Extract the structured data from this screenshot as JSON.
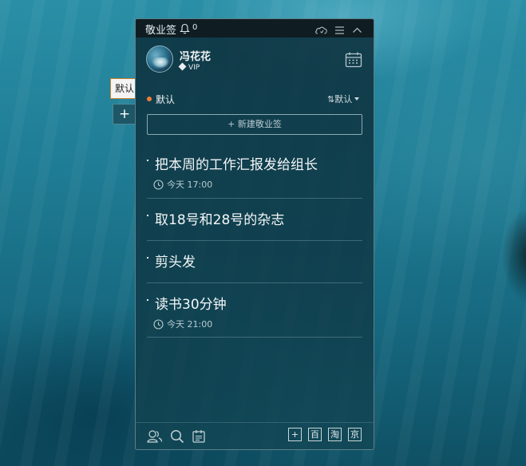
{
  "window": {
    "title": "敬业签",
    "notification_count": "0"
  },
  "side_tabs": {
    "category_label": "默认",
    "add_label": "+"
  },
  "profile": {
    "name": "冯花花",
    "badge": "VIP"
  },
  "category": {
    "name": "默认",
    "dot_color": "#ef7d35",
    "sort_label": "⇅默认"
  },
  "new_button": {
    "label": "+ 新建敬业签"
  },
  "tasks": [
    {
      "text": "把本周的工作汇报发给组长",
      "due": "今天 17:00"
    },
    {
      "text": "取18号和28号的杂志",
      "due": ""
    },
    {
      "text": "剪头发",
      "due": ""
    },
    {
      "text": "读书30分钟",
      "due": "今天 21:00"
    }
  ],
  "bottom_bar": {
    "icons": [
      "contacts-icon",
      "search-icon",
      "notes-icon"
    ],
    "shortcuts": [
      "+",
      "百",
      "淘",
      "京"
    ]
  }
}
